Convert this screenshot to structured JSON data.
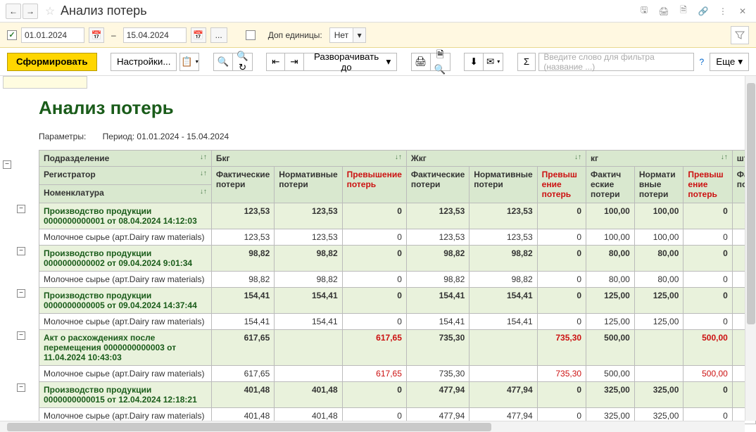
{
  "title": "Анализ потерь",
  "date_from": "01.01.2024",
  "date_to": "15.04.2024",
  "extra_units_label": "Доп единицы:",
  "extra_units_value": "Нет",
  "toolbar": {
    "generate": "Сформировать",
    "settings": "Настройки...",
    "expand_to": "Разворачивать до",
    "more": "Еще",
    "search_placeholder": "Введите слово для фильтра (название ...)"
  },
  "report": {
    "title": "Анализ потерь",
    "params_label": "Параметры:",
    "period_text": "Период: 01.01.2024 - 15.04.2024",
    "group_headers": [
      "Подразделение",
      "Регистратор",
      "Номенклатура"
    ],
    "unit_headers": [
      "Бкг",
      "Жкг",
      "кг",
      "шт"
    ],
    "col_headers": {
      "fact": "Фактические потери",
      "norm": "Нормативные потери",
      "exceed": "Превышение потерь",
      "fact_short": "Фактич еские потери",
      "norm_short": "Нормати вные потери",
      "exceed_short": "Превыш ение потерь",
      "fa": "Фа пот"
    },
    "rows": [
      {
        "type": "summary",
        "desc": "Производство продукции 0000000000001 от 08.04.2024 14:12:03",
        "v": [
          "123,53",
          "123,53",
          "0",
          "123,53",
          "123,53",
          "0",
          "100,00",
          "100,00",
          "0"
        ]
      },
      {
        "type": "detail",
        "desc": "Молочное сырье (арт.Dairy raw materials)",
        "v": [
          "123,53",
          "123,53",
          "0",
          "123,53",
          "123,53",
          "0",
          "100,00",
          "100,00",
          "0"
        ]
      },
      {
        "type": "summary",
        "desc": "Производство продукции 0000000000002 от 09.04.2024 9:01:34",
        "v": [
          "98,82",
          "98,82",
          "0",
          "98,82",
          "98,82",
          "0",
          "80,00",
          "80,00",
          "0"
        ]
      },
      {
        "type": "detail",
        "desc": "Молочное сырье (арт.Dairy raw materials)",
        "v": [
          "98,82",
          "98,82",
          "0",
          "98,82",
          "98,82",
          "0",
          "80,00",
          "80,00",
          "0"
        ]
      },
      {
        "type": "summary",
        "desc": "Производство продукции 0000000000005 от 09.04.2024 14:37:44",
        "v": [
          "154,41",
          "154,41",
          "0",
          "154,41",
          "154,41",
          "0",
          "125,00",
          "125,00",
          "0"
        ]
      },
      {
        "type": "detail",
        "desc": "Молочное сырье (арт.Dairy raw materials)",
        "v": [
          "154,41",
          "154,41",
          "0",
          "154,41",
          "154,41",
          "0",
          "125,00",
          "125,00",
          "0"
        ]
      },
      {
        "type": "summary",
        "desc": "Акт о расхождениях после перемещения 0000000000003 от 11.04.2024 10:43:03",
        "v": [
          "617,65",
          "",
          "617,65",
          "735,30",
          "",
          "735,30",
          "500,00",
          "",
          "500,00"
        ],
        "red_cols": [
          2,
          5,
          8
        ]
      },
      {
        "type": "detail",
        "desc": "Молочное сырье (арт.Dairy raw materials)",
        "v": [
          "617,65",
          "",
          "617,65",
          "735,30",
          "",
          "735,30",
          "500,00",
          "",
          "500,00"
        ],
        "red_cols": [
          2,
          5,
          8
        ]
      },
      {
        "type": "summary",
        "desc": "Производство продукции 0000000000015 от 12.04.2024 12:18:21",
        "v": [
          "401,48",
          "401,48",
          "0",
          "477,94",
          "477,94",
          "0",
          "325,00",
          "325,00",
          "0"
        ]
      },
      {
        "type": "detail",
        "desc": "Молочное сырье (арт.Dairy raw materials)",
        "v": [
          "401,48",
          "401,48",
          "0",
          "477,94",
          "477,94",
          "0",
          "325,00",
          "325,00",
          "0"
        ]
      }
    ]
  }
}
